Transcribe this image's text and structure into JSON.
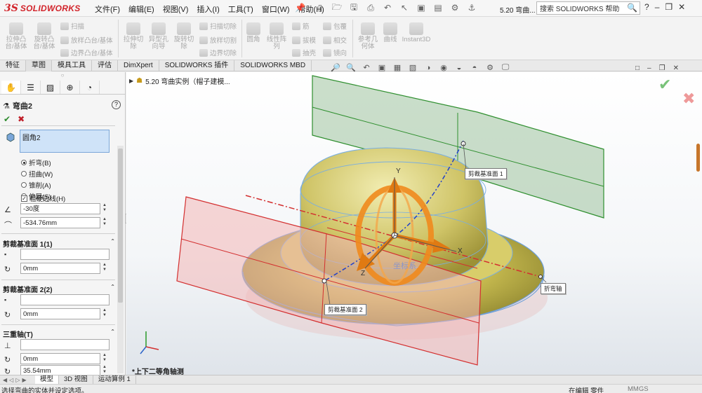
{
  "app": {
    "logo_mark": "3S",
    "logo_text": "SOLIDWORKS",
    "document_title": "5.20 弯曲...",
    "search_placeholder": "搜索 SOLIDWORKS 帮助"
  },
  "menu": [
    "文件(F)",
    "编辑(E)",
    "视图(V)",
    "插入(I)",
    "工具(T)",
    "窗口(W)",
    "帮助(H)"
  ],
  "command_manager": {
    "large": [
      {
        "label": "拉伸凸\n台/基体"
      },
      {
        "label": "旋转凸\n台/基体"
      },
      {
        "label": "拉伸切\n除"
      },
      {
        "label": "异型孔\n向导"
      },
      {
        "label": "旋转切\n除"
      },
      {
        "label": "圆角"
      },
      {
        "label": "线性阵\n列"
      },
      {
        "label": "参考几\n何体"
      },
      {
        "label": "曲线"
      },
      {
        "label": "Instant3D"
      }
    ],
    "small": [
      "扫描",
      "放样凸台/基体",
      "边界凸台/基体",
      "扫描切除",
      "放样切割",
      "边界切除",
      "筋",
      "拔模",
      "抽壳",
      "包覆",
      "相交",
      "镜向"
    ]
  },
  "tabs": [
    "特征",
    "草图",
    "模具工具",
    "评估",
    "DimXpert",
    "SOLIDWORKS 插件",
    "SOLIDWORKS MBD"
  ],
  "property_manager": {
    "feature_name": "弯曲2",
    "help": "?",
    "selection": "圆角2",
    "options": [
      {
        "label": "折弯(B)",
        "selected": true
      },
      {
        "label": "扭曲(W)",
        "selected": false
      },
      {
        "label": "锥削(A)",
        "selected": false
      },
      {
        "label": "伸展(S)",
        "selected": false
      }
    ],
    "hard_edges": {
      "label": "粗硬边线(H)",
      "checked": true
    },
    "angle": "-30度",
    "radius": "-534.76mm",
    "trim_plane1": {
      "title": "剪裁基准面 1(1)",
      "value": "",
      "distance": "0mm"
    },
    "trim_plane2": {
      "title": "剪裁基准面 2(2)",
      "value": "",
      "distance": "0mm"
    },
    "triad": {
      "title": "三重轴(T)",
      "value": "",
      "rot1": "0mm",
      "rot2": "35.54mm"
    }
  },
  "viewport": {
    "tree_root": "5.20 弯曲实例（帽子建模...",
    "view_name": "*上下二等角轴测",
    "callouts": {
      "plane1": "剪裁基准面 1",
      "plane2": "剪裁基准面 2",
      "bend_axis": "折弯轴"
    },
    "triad_labels": {
      "y": "Y",
      "x": "X",
      "z": "Z",
      "origin": "坐标系"
    }
  },
  "bottom_tabs": [
    "模型",
    "3D 视图",
    "运动算例 1"
  ],
  "status": {
    "message": "选择弯曲的实体并设定选项。",
    "mode": "在编辑 零件",
    "units": "MMGS"
  },
  "colors": {
    "brand": "#d2232a",
    "plane_green": "#2f8f2f",
    "plane_red": "#d32f2f",
    "hat_fill": "#bfb24a",
    "triad_orange": "#f08a1d",
    "selection_blue": "#cfe3f8"
  }
}
